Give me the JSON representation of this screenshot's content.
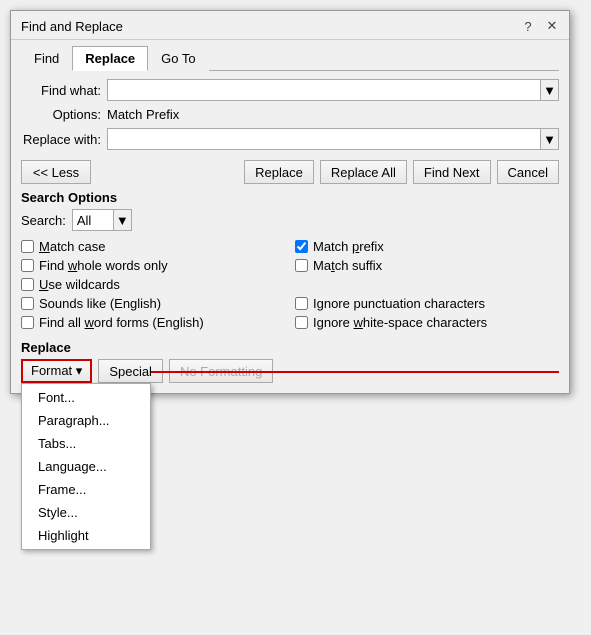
{
  "dialog": {
    "title": "Find and Replace",
    "help_icon": "?",
    "close_icon": "✕"
  },
  "tabs": [
    {
      "id": "find",
      "label": "Find",
      "active": false
    },
    {
      "id": "replace",
      "label": "Replace",
      "active": true
    },
    {
      "id": "goto",
      "label": "Go To",
      "active": false
    }
  ],
  "find_what": {
    "label": "Find what:",
    "value": "",
    "placeholder": ""
  },
  "options_row": {
    "label": "Options:",
    "value": "Match Prefix"
  },
  "replace_with": {
    "label": "Replace with:",
    "value": "",
    "placeholder": ""
  },
  "buttons": {
    "less": "<< Less",
    "replace": "Replace",
    "replace_all": "Replace All",
    "find_next": "Find Next",
    "cancel": "Cancel"
  },
  "search_options": {
    "title": "Search Options",
    "search_label": "Search:",
    "search_value": "All"
  },
  "checkboxes": {
    "left": [
      {
        "id": "match-case",
        "label": "Match case",
        "checked": false,
        "underline_index": 0
      },
      {
        "id": "whole-words",
        "label": "Find whole words only",
        "checked": false,
        "underline_index": 5
      },
      {
        "id": "wildcards",
        "label": "Use wildcards",
        "checked": false,
        "underline_index": 0
      },
      {
        "id": "sounds-like",
        "label": "Sounds like (English)",
        "checked": false,
        "underline_index": 0
      },
      {
        "id": "word-forms",
        "label": "Find all word forms (English)",
        "checked": false,
        "underline_index": 0
      }
    ],
    "right": [
      {
        "id": "match-prefix",
        "label": "Match prefix",
        "checked": true,
        "underline_index": 6
      },
      {
        "id": "match-suffix",
        "label": "Match suffix",
        "checked": false,
        "underline_index": 6
      },
      {
        "id": "ignore-punct",
        "label": "Ignore punctuation characters",
        "checked": false,
        "underline_index": 0
      },
      {
        "id": "ignore-space",
        "label": "Ignore white-space characters",
        "checked": false,
        "underline_index": 0
      }
    ]
  },
  "replace_section": {
    "title": "Replace",
    "format_btn": "Format ▾",
    "special_btn": "Special",
    "no_formatting_btn": "No Formatting"
  },
  "dropdown_menu": {
    "items": [
      "Font...",
      "Paragraph...",
      "Tabs...",
      "Language...",
      "Frame...",
      "Style...",
      "Highlight"
    ]
  }
}
